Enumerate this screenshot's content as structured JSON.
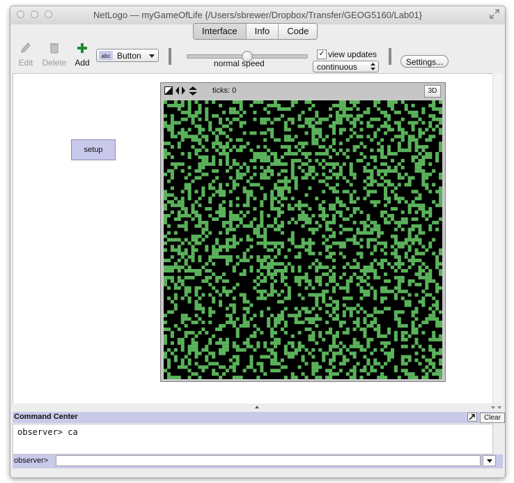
{
  "window": {
    "title": "NetLogo — myGameOfLife {/Users/sbrewer/Dropbox/Transfer/GEOG5160/Lab01}"
  },
  "tabs": [
    {
      "label": "Interface",
      "active": true
    },
    {
      "label": "Info",
      "active": false
    },
    {
      "label": "Code",
      "active": false
    }
  ],
  "toolbar": {
    "edit_label": "Edit",
    "delete_label": "Delete",
    "add_label": "Add",
    "widget_type": "Button",
    "widget_icon_text": "abc",
    "speed_label": "normal speed",
    "speed_value": 0.5,
    "view_updates_label": "view updates",
    "view_updates_checked": true,
    "update_mode": "continuous",
    "settings_label": "Settings..."
  },
  "interface": {
    "setup_button_label": "setup"
  },
  "view": {
    "ticks_text": "ticks: 0",
    "button_3d_label": "3D",
    "world_columns": 81,
    "live_cell_fraction": 0.35,
    "live_color": "#5bb35b",
    "dead_color": "#000000"
  },
  "command_center": {
    "title": "Command Center",
    "clear_label": "Clear",
    "output_lines": [
      "observer> ca"
    ],
    "prompt_label": "observer>",
    "input_value": ""
  },
  "colors": {
    "button_bg": "#c9c9ec",
    "command_bar_bg": "#c9c9ea"
  }
}
